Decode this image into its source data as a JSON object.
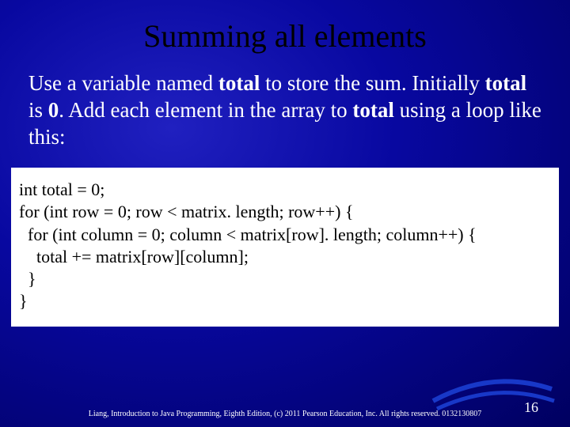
{
  "title": "Summing all elements",
  "body": {
    "p1a": "Use a variable named ",
    "p1b": "total",
    "p1c": " to store the sum. Initially ",
    "p1d": "total",
    "p1e": " is ",
    "p1f": "0",
    "p1g": ". Add each  element in the array to ",
    "p1h": "total",
    "p1i": " using a loop like this:"
  },
  "code": {
    "l1": "int total = 0;",
    "l2": "for (int row = 0; row < matrix. length; row++) {",
    "l3": "  for (int column = 0; column < matrix[row]. length; column++) {",
    "l4": "    total += matrix[row][column];",
    "l5": "  }",
    "l6": "}"
  },
  "footer": "Liang, Introduction to Java Programming, Eighth Edition, (c) 2011 Pearson Education, Inc. All rights reserved. 0132130807",
  "page": "16"
}
